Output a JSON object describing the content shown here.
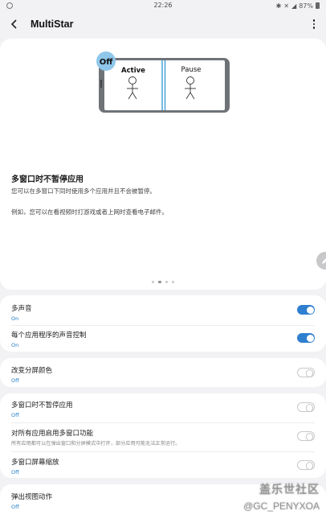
{
  "status": {
    "time": "22:26",
    "battery": "87%"
  },
  "toolbar": {
    "title": "MultiStar"
  },
  "hero": {
    "badge": "Off",
    "left_label": "Active",
    "right_label": "Pause",
    "heading": "多窗口时不暂停应用",
    "desc1": "您可以在多窗口下同时使用多个应用并且不会被暂停。",
    "desc2": "例如，您可以在看视频时打游戏或者上网时查看电子邮件。",
    "page_count": 4,
    "active_page": 1
  },
  "groups": [
    {
      "items": [
        {
          "label": "多声音",
          "sub": "On",
          "on": true
        },
        {
          "label": "每个应用程序的声音控制",
          "sub": "On",
          "on": true
        }
      ]
    },
    {
      "items": [
        {
          "label": "改变分屏颜色",
          "sub": "Off",
          "on": false
        }
      ]
    },
    {
      "items": [
        {
          "label": "多窗口时不暂停应用",
          "sub": "Off",
          "on": false
        },
        {
          "label": "对所有应用启用多窗口功能",
          "desc": "所有应用都可以在弹出窗口和分屏模式中打开，部分应用可能无法正常运行。",
          "on": false
        },
        {
          "label": "多窗口屏幕缩放",
          "sub": "Off",
          "on": false
        }
      ]
    },
    {
      "items": [
        {
          "label": "弹出视图动作",
          "sub": "Off"
        }
      ]
    }
  ],
  "watermark": {
    "line1": "盖乐世社区",
    "line2": "@GC_PENYXOA"
  },
  "colors": {
    "accent": "#2f7fd1",
    "background": "#f2f2f4",
    "card": "#ffffff"
  }
}
